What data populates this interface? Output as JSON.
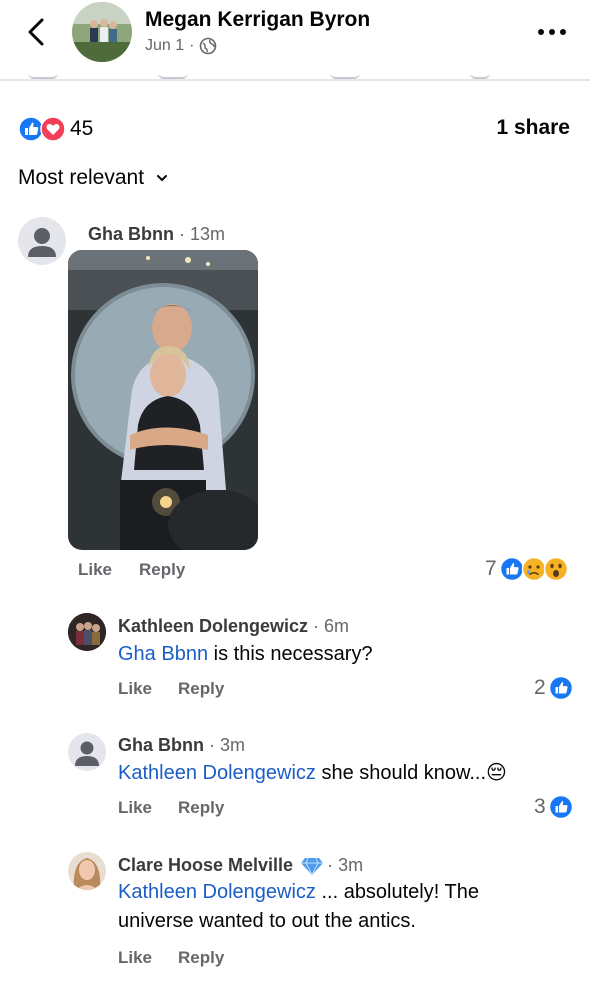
{
  "post": {
    "author": "Megan Kerrigan Byron",
    "date": "Jun 1",
    "meta_sep": "·",
    "privacy_icon": "globe-icon",
    "reactions_count": "45",
    "reaction_icons": [
      "like-icon",
      "love-icon"
    ],
    "shares": "1 share"
  },
  "sort": {
    "label": "Most relevant",
    "icon": "chevron-down-icon"
  },
  "colors": {
    "like_blue": "#1877f2",
    "love_red": "#f33e58",
    "mention_blue": "#1a5ec7",
    "secondary_text": "#65676b"
  },
  "comments": [
    {
      "name": "Gha Bbnn",
      "time": " · 13m",
      "has_photo": true,
      "like_label": "Like",
      "reply_label": "Reply",
      "reactions_count": "7",
      "reaction_icons": [
        "like-icon",
        "sad-icon",
        "wow-icon"
      ]
    },
    {
      "name": "Kathleen Dolengewicz",
      "time": " · 6m",
      "mention": "Gha Bbnn",
      "text": " is this necessary?",
      "like_label": "Like",
      "reply_label": "Reply",
      "reactions_count": "2",
      "reaction_icons": [
        "like-icon"
      ]
    },
    {
      "name": "Gha Bbnn",
      "time": " · 3m",
      "mention": "Kathleen Dolengewicz",
      "text": " she should know...",
      "emoji": "😔",
      "like_label": "Like",
      "reply_label": "Reply",
      "reactions_count": "3",
      "reaction_icons": [
        "like-icon"
      ]
    },
    {
      "name": "Clare Hoose Melville",
      "badge_icon": "diamond-icon",
      "time": " · 3m",
      "mention": "Kathleen Dolengewicz",
      "text": " ... absolutely! The universe wanted to out the antics.",
      "like_label": "Like",
      "reply_label": "Reply"
    }
  ]
}
